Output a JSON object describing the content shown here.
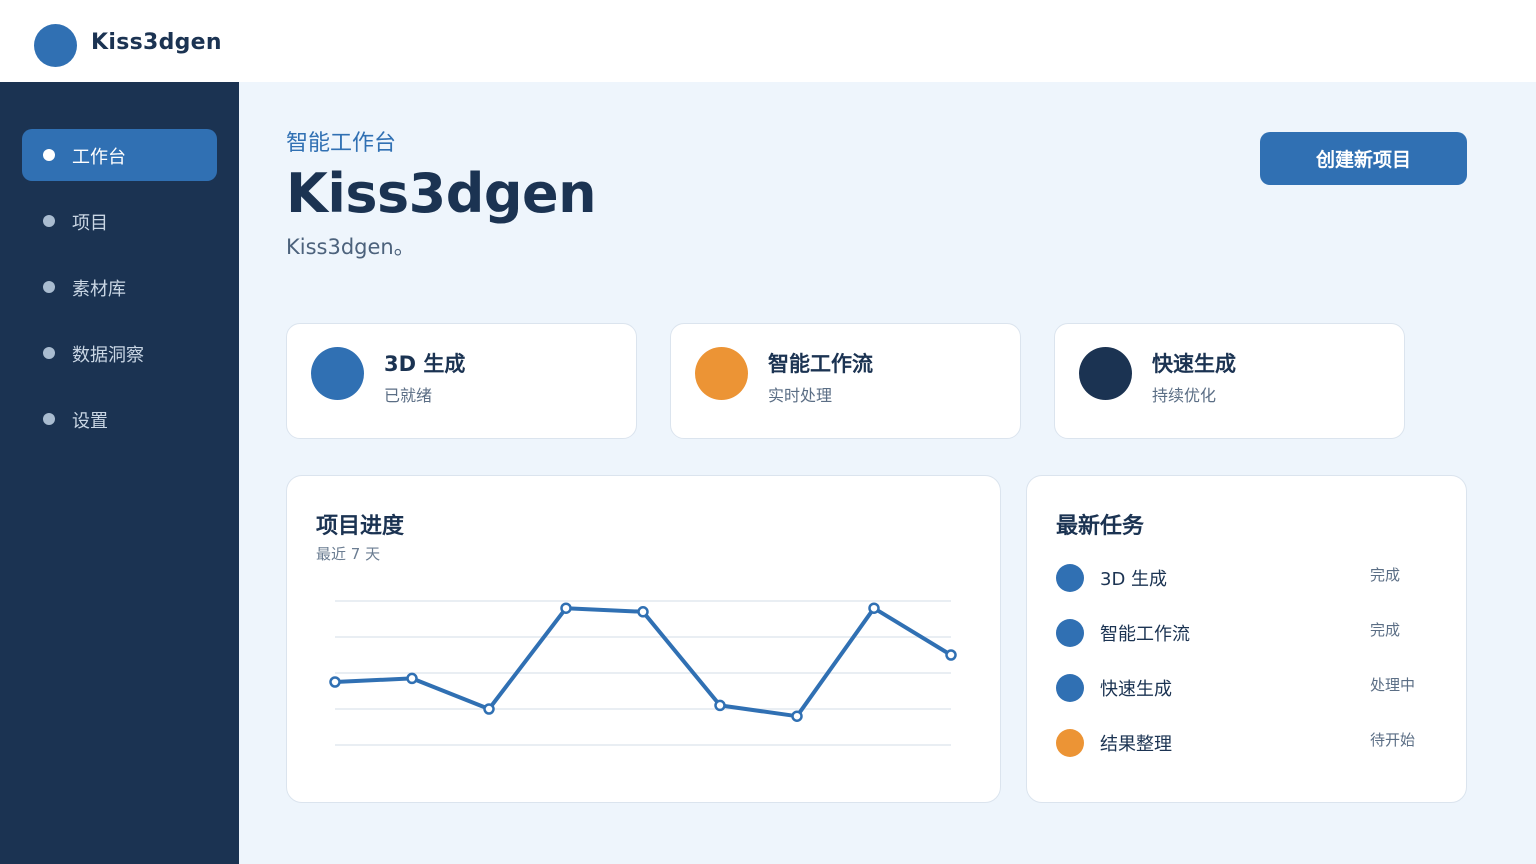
{
  "app": {
    "brand": "Kiss3dgen"
  },
  "sidebar": {
    "items": [
      {
        "label": "工作台",
        "active": true
      },
      {
        "label": "项目",
        "active": false
      },
      {
        "label": "素材库",
        "active": false
      },
      {
        "label": "数据洞察",
        "active": false
      },
      {
        "label": "设置",
        "active": false
      }
    ]
  },
  "header": {
    "eyebrow": "智能工作台",
    "title": "Kiss3dgen",
    "subtitle": "Kiss3dgen。",
    "create_label": "创建新项目"
  },
  "stats": [
    {
      "title": "3D 生成",
      "sub": "已就绪",
      "color": "#3070b3"
    },
    {
      "title": "智能工作流",
      "sub": "实时处理",
      "color": "#ec9435"
    },
    {
      "title": "快速生成",
      "sub": "持续优化",
      "color": "#1b3352"
    }
  ],
  "progress": {
    "title": "项目进度",
    "subtitle": "最近 7 天"
  },
  "chart_data": {
    "type": "line",
    "x": [
      1,
      2,
      3,
      4,
      5,
      6,
      7,
      8,
      9
    ],
    "values": [
      35,
      37,
      20,
      76,
      74,
      22,
      16,
      76,
      50
    ],
    "ylim": [
      0,
      80
    ],
    "grid": true,
    "color": "#3070b3",
    "title": "",
    "xlabel": "",
    "ylabel": ""
  },
  "tasks": {
    "title": "最新任务",
    "items": [
      {
        "label": "3D 生成",
        "status": "完成",
        "color": "#3070b3"
      },
      {
        "label": "智能工作流",
        "status": "完成",
        "color": "#3070b3"
      },
      {
        "label": "快速生成",
        "status": "处理中",
        "color": "#3070b3"
      },
      {
        "label": "结果整理",
        "status": "待开始",
        "color": "#ec9435"
      }
    ]
  }
}
